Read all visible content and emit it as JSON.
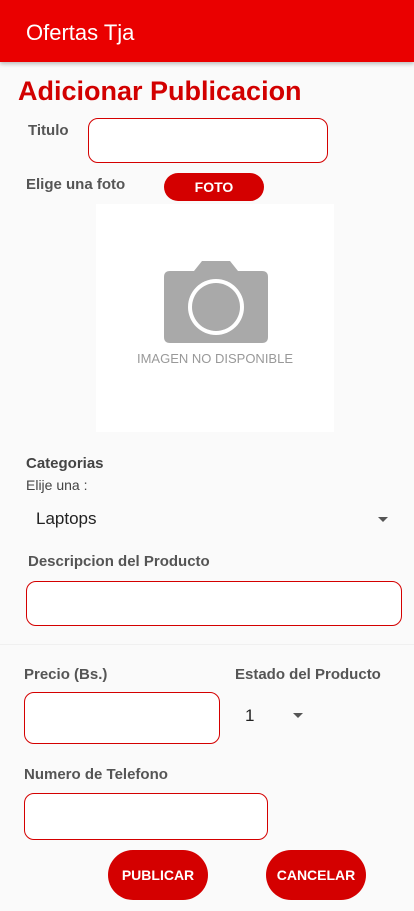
{
  "appbar": {
    "title": "Ofertas Tja"
  },
  "heading": "Adicionar Publicacion",
  "form": {
    "titulo_label": "Titulo",
    "titulo_value": "",
    "foto_label": "Elige una foto",
    "foto_button": "FOTO",
    "image_placeholder": "IMAGEN NO DISPONIBLE",
    "categorias_label": "Categorias",
    "categorias_hint": "Elije una :",
    "categoria_selected": "Laptops",
    "descripcion_label": "Descripcion del Producto",
    "descripcion_value": "",
    "precio_label": "Precio (Bs.)",
    "precio_value": "",
    "estado_label": "Estado del Producto",
    "estado_selected": "1",
    "telefono_label": "Numero de Telefono",
    "telefono_value": ""
  },
  "actions": {
    "publicar": "PUBLICAR",
    "cancelar": "CANCELAR"
  },
  "colors": {
    "primary": "#ea0000",
    "accent": "#d40000"
  }
}
